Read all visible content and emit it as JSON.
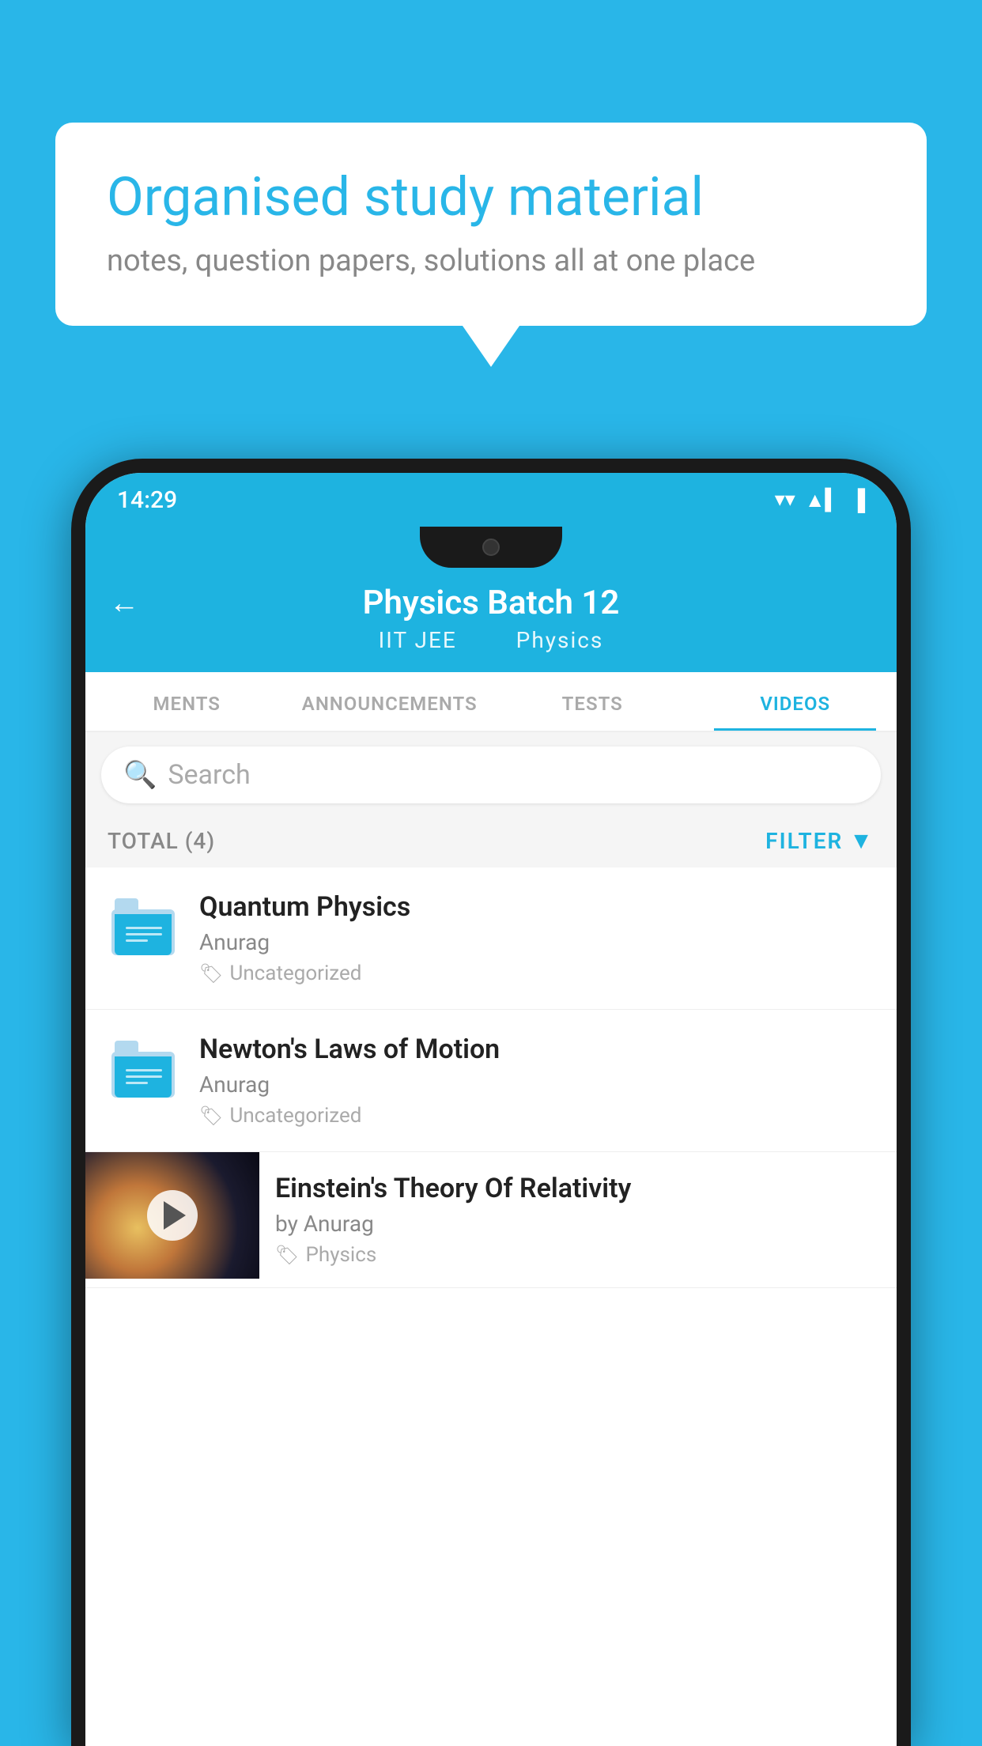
{
  "page": {
    "background_color": "#29b6e8"
  },
  "speech_bubble": {
    "title": "Organised study material",
    "subtitle": "notes, question papers, solutions all at one place"
  },
  "phone": {
    "status_bar": {
      "time": "14:29",
      "wifi_icon": "▼",
      "signal_icon": "▲",
      "battery_icon": "▐"
    },
    "header": {
      "back_label": "←",
      "title": "Physics Batch 12",
      "subtitle_part1": "IIT JEE",
      "subtitle_part2": "Physics"
    },
    "tabs": [
      {
        "label": "MENTS",
        "active": false
      },
      {
        "label": "ANNOUNCEMENTS",
        "active": false
      },
      {
        "label": "TESTS",
        "active": false
      },
      {
        "label": "VIDEOS",
        "active": true
      }
    ],
    "search": {
      "placeholder": "Search"
    },
    "filter_bar": {
      "total_label": "TOTAL (4)",
      "filter_label": "FILTER"
    },
    "videos": [
      {
        "title": "Quantum Physics",
        "author": "Anurag",
        "tag": "Uncategorized",
        "has_thumbnail": false
      },
      {
        "title": "Newton's Laws of Motion",
        "author": "Anurag",
        "tag": "Uncategorized",
        "has_thumbnail": false
      },
      {
        "title": "Einstein's Theory Of Relativity",
        "author": "by Anurag",
        "tag": "Physics",
        "has_thumbnail": true
      }
    ]
  }
}
